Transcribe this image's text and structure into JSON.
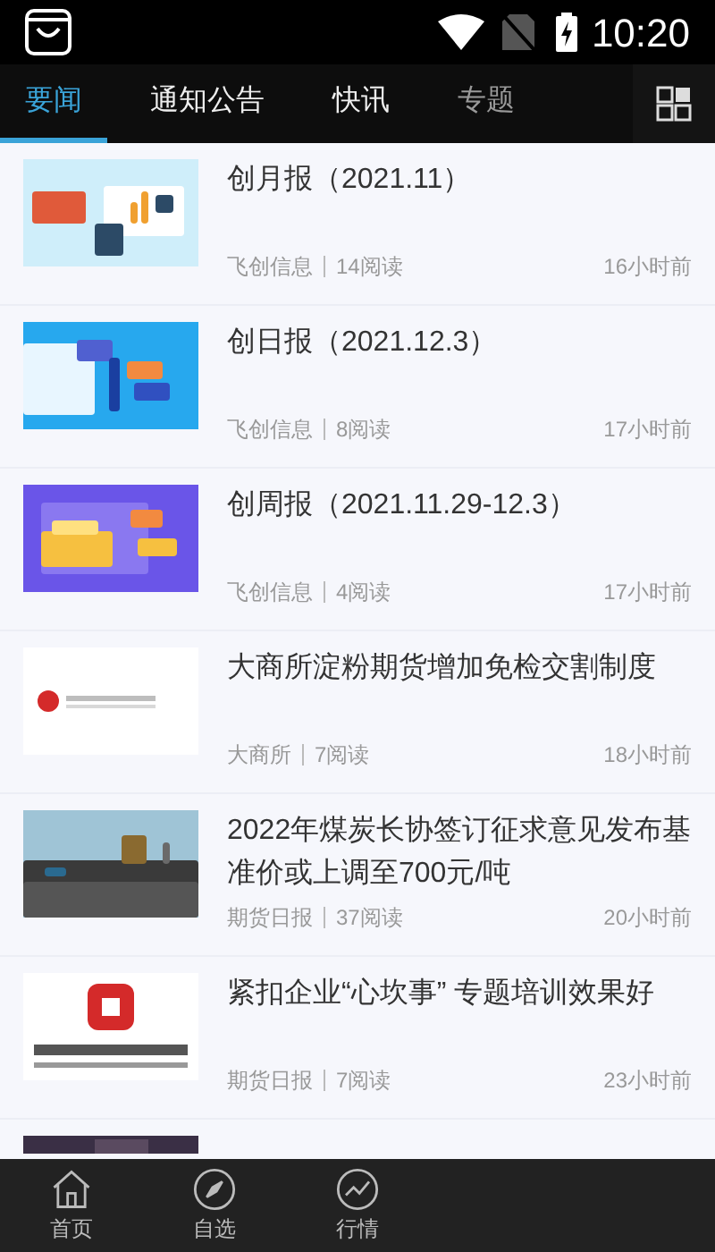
{
  "status_bar": {
    "time": "10:20"
  },
  "tabs": [
    {
      "label": "要闻",
      "selected": true
    },
    {
      "label": "通知公告",
      "selected": false
    },
    {
      "label": "快讯",
      "selected": false
    },
    {
      "label": "专题",
      "selected": false
    }
  ],
  "articles": [
    {
      "title": "创月报（2021.11）",
      "source": "飞创信息",
      "reads": "14阅读",
      "time": "16小时前"
    },
    {
      "title": "创日报（2021.12.3）",
      "source": "飞创信息",
      "reads": "8阅读",
      "time": "17小时前"
    },
    {
      "title": "创周报（2021.11.29-12.3）",
      "source": "飞创信息",
      "reads": "4阅读",
      "time": "17小时前"
    },
    {
      "title": "大商所淀粉期货增加免检交割制度",
      "source": "大商所",
      "reads": "7阅读",
      "time": "18小时前"
    },
    {
      "title": "2022年煤炭长协签订征求意见发布基准价或上调至700元/吨",
      "source": "期货日报",
      "reads": "37阅读",
      "time": "20小时前"
    },
    {
      "title": "紧扣企业“心坎事” 专题培训效果好",
      "source": "期货日报",
      "reads": "7阅读",
      "time": "23小时前"
    }
  ],
  "bottom_nav": [
    {
      "label": "首页",
      "selected": false
    },
    {
      "label": "自选",
      "selected": false
    },
    {
      "label": "行情",
      "selected": false
    }
  ]
}
